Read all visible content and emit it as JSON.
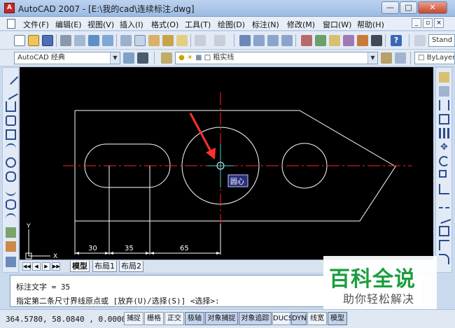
{
  "window": {
    "title": "AutoCAD 2007 - [E:\\我的cad\\连续标注.dwg]",
    "minimize": "—",
    "maximize": "□",
    "close": "✕"
  },
  "menu": {
    "items": [
      "文件(F)",
      "编辑(E)",
      "视图(V)",
      "插入(I)",
      "格式(O)",
      "工具(T)",
      "绘图(D)",
      "标注(N)",
      "修改(M)",
      "窗口(W)",
      "帮助(H)"
    ],
    "mdi_min": "_",
    "mdi_restore": "▫",
    "mdi_close": "×"
  },
  "toolbar": {
    "text_style": "Stand",
    "workspace": "AutoCAD 经典",
    "layer": "粗实线",
    "color": "ByLayer"
  },
  "drawing": {
    "dim_values": [
      "30",
      "35",
      "65"
    ],
    "tooltip": "圆心",
    "ucs_x": "X",
    "ucs_y": "Y",
    "colors": {
      "geometry": "#ffffff",
      "centerline": "#ff2020",
      "dimension": "#40d0d0",
      "arrow": "#ff3030",
      "tooltip_bg": "#2a2f7a"
    }
  },
  "tabs": {
    "items": [
      "模型",
      "布局1",
      "布局2"
    ],
    "active": "模型"
  },
  "command": {
    "line1": "标注文字 = 35",
    "line2": "指定第二条尺寸界线原点或 [放弃(U)/选择(S)] <选择>:"
  },
  "status": {
    "coordinates": "364.5780, 58.0840 , 0.0000",
    "buttons": [
      "捕捉",
      "栅格",
      "正交",
      "极轴",
      "对象捕捉",
      "对象追踪",
      "DUCS",
      "DYN",
      "线宽",
      "模型"
    ]
  },
  "watermark": {
    "main": "百科全说",
    "sub": "助你轻松解决"
  }
}
